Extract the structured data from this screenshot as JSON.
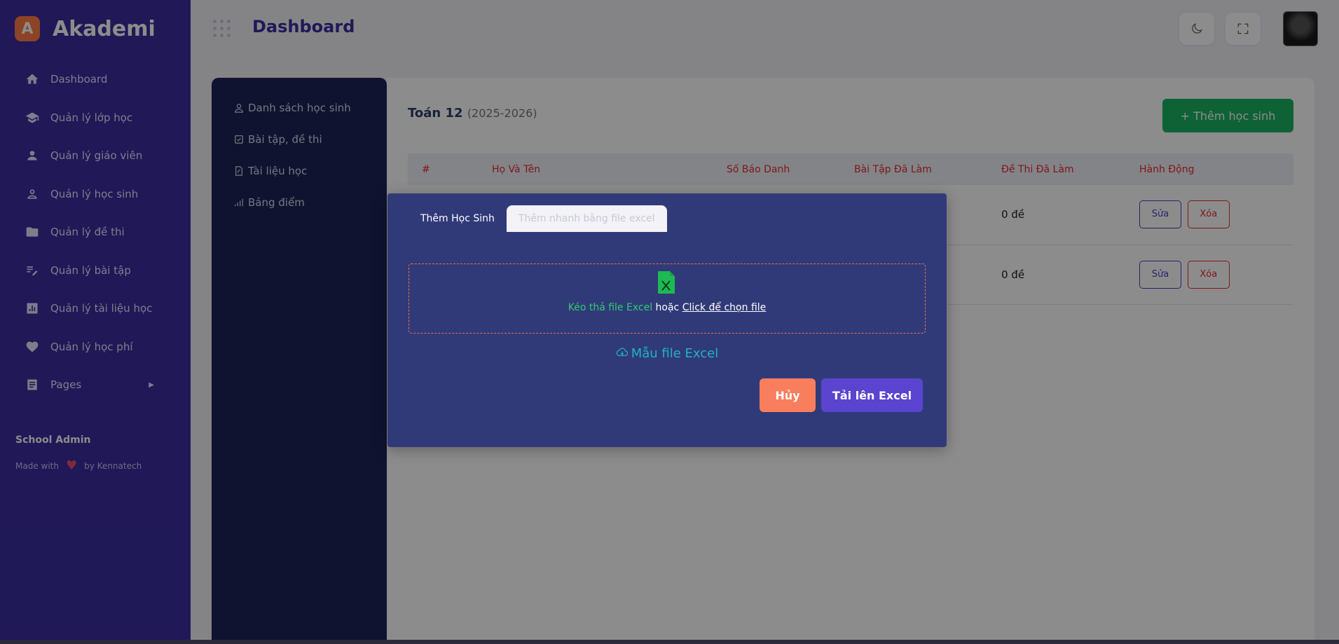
{
  "brand": {
    "logo_letter": "A",
    "name": "Akademi"
  },
  "sidebar": {
    "items": [
      {
        "label": "Dashboard",
        "icon": "home-icon"
      },
      {
        "label": "Quản lý lớp học",
        "icon": "graduation-cap-icon"
      },
      {
        "label": "Quản lý giáo viên",
        "icon": "person-icon"
      },
      {
        "label": "Quản lý học sinh",
        "icon": "person-outline-icon"
      },
      {
        "label": "Quản lý đề thi",
        "icon": "folder-icon"
      },
      {
        "label": "Quản lý bài tập",
        "icon": "edit-note-icon"
      },
      {
        "label": "Quản lý tài liệu học",
        "icon": "chart-box-icon"
      },
      {
        "label": "Quản lý học phí",
        "icon": "heart-icon"
      },
      {
        "label": "Pages",
        "icon": "page-icon"
      }
    ],
    "footer": {
      "role": "School Admin",
      "made_with": "Made with",
      "by": "by Kennatech"
    }
  },
  "header": {
    "title": "Dashboard"
  },
  "subnav": {
    "items": [
      {
        "label": "Danh sách học sinh",
        "icon": "person-icon"
      },
      {
        "label": "Bài tập, đề thi",
        "icon": "checkbox-icon"
      },
      {
        "label": "Tài liệu học",
        "icon": "pdf-file-icon"
      },
      {
        "label": "Bảng điểm",
        "icon": "bar-chart-icon"
      }
    ]
  },
  "main": {
    "class_name": "Toán 12",
    "class_year": "(2025-2026)",
    "add_button": "+ Thêm học sinh",
    "table": {
      "headers": [
        "#",
        "Họ Và Tên",
        "Số Báo Danh",
        "Bài Tập Đã Làm",
        "Đề Thi Đã Làm",
        "Hành Động"
      ],
      "rows": [
        {
          "exams": "0 đề",
          "edit": "Sửa",
          "delete": "Xóa"
        },
        {
          "exams": "0 đề",
          "edit": "Sửa",
          "delete": "Xóa"
        }
      ]
    }
  },
  "modal": {
    "tabs": [
      "Thêm Học Sinh",
      "Thêm nhanh bằng file excel"
    ],
    "drop_text_green": "Kéo thả file Excel",
    "drop_text_or": " hoặc ",
    "drop_text_link": "Click để chọn file",
    "template_link": "Mẫu file Excel",
    "cancel_button": "Hủy",
    "upload_button": "Tải lên Excel"
  },
  "colors": {
    "sidebar_bg": "#3b2d9e",
    "accent_orange": "#f97e5e",
    "accent_green": "#1cb363",
    "modal_bg": "#313a78"
  }
}
